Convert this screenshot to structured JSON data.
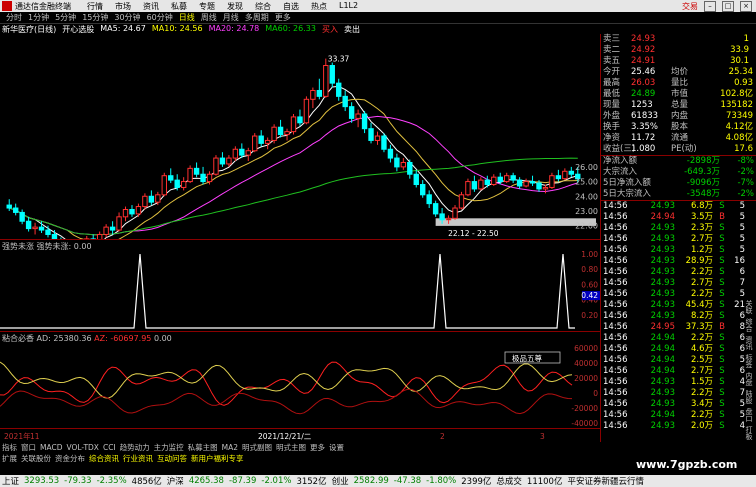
{
  "app": {
    "title": "通达信金融终端",
    "menu": [
      "行情",
      "市场",
      "资讯",
      "私募",
      "专题",
      "发现",
      "综合",
      "自选",
      "热点",
      "L1L2"
    ],
    "trade": "交易"
  },
  "periods": [
    "分时",
    "1分钟",
    "5分钟",
    "15分钟",
    "30分钟",
    "60分钟",
    "日线",
    "周线",
    "月线",
    "多周期",
    "更多"
  ],
  "selected_period": "日线",
  "stock": {
    "name": "新华医疗(日线)",
    "indicator": "开心选股",
    "ma5": "MA5: 24.67",
    "ma10": "MA10: 24.56",
    "ma20": "MA20: 24.78",
    "ma60": "MA60: 26.33",
    "buy": "买入",
    "sell": "卖出"
  },
  "price_axis": [
    "26.00",
    "25.00",
    "24.00",
    "23.00",
    "22.00"
  ],
  "annotations": {
    "high": "33.37",
    "low": "19.38",
    "band": "22.12 - 22.50"
  },
  "pane2": {
    "title": "强势未涨  强势未涨: 0.00",
    "axis": [
      "1.00",
      "0.80",
      "0.60",
      "0.40",
      "0.20"
    ],
    "marker": "0.42"
  },
  "pane3": {
    "title": "粘合必香  AD: 25380.36",
    "title2": "AZ: -60697.95",
    "title3": "0.00",
    "axis": [
      "60000",
      "40000",
      "20000",
      "0",
      "-20000",
      "-40000"
    ],
    "box": "极品五尊"
  },
  "dates": [
    "2021年",
    "11",
    "2021/12/21/二",
    "2",
    "3"
  ],
  "quote": [
    {
      "k": "卖三",
      "v": "24.93",
      "n": "1"
    },
    {
      "k": "卖二",
      "v": "24.92",
      "n": "33.9"
    },
    {
      "k": "卖五",
      "v": "24.91",
      "n": "30.1"
    },
    {
      "k": "今开",
      "v": "25.46",
      "k2": "均价",
      "v2": "25.34"
    },
    {
      "k": "最高",
      "v": "26.03",
      "k2": "量比",
      "v2": "0.93"
    },
    {
      "k": "最低",
      "v": "24.89",
      "k2": "市值",
      "v2": "102.8亿"
    },
    {
      "k": "现量",
      "v": "1253",
      "k2": "总量",
      "v2": "135182"
    },
    {
      "k": "外盘",
      "v": "61833",
      "k2": "内盘",
      "v2": "73349"
    },
    {
      "k": "换手",
      "v": "3.35%",
      "k2": "股本",
      "v2": "4.12亿"
    },
    {
      "k": "净资",
      "v": "11.72",
      "k2": "流通",
      "v2": "4.08亿"
    },
    {
      "k": "收益(三)",
      "v": "1.080",
      "k2": "PE(动)",
      "v2": "17.6"
    }
  ],
  "flows": [
    {
      "k": "净流入额",
      "v": "-2898万",
      "p": "-8%"
    },
    {
      "k": "大宗流入",
      "v": "-649.3万",
      "p": "-2%"
    },
    {
      "k": "5日净流入额",
      "v": "-9096万",
      "p": "-7%"
    },
    {
      "k": "5日大宗流入",
      "v": "-3548万",
      "p": "-2%"
    }
  ],
  "ticks": [
    {
      "t": "14:56",
      "p": "24.93",
      "v": "6.8万",
      "f": "S",
      "n": "5"
    },
    {
      "t": "14:56",
      "p": "24.94",
      "v": "3.5万",
      "f": "B",
      "n": "5"
    },
    {
      "t": "14:56",
      "p": "24.93",
      "v": "2.3万",
      "f": "S",
      "n": "5"
    },
    {
      "t": "14:56",
      "p": "24.93",
      "v": "2.7万",
      "f": "S",
      "n": "5"
    },
    {
      "t": "14:56",
      "p": "24.93",
      "v": "1.2万",
      "f": "S",
      "n": "5"
    },
    {
      "t": "14:56",
      "p": "24.93",
      "v": "28.9万",
      "f": "S",
      "n": "16"
    },
    {
      "t": "14:56",
      "p": "24.93",
      "v": "2.2万",
      "f": "S",
      "n": "6"
    },
    {
      "t": "14:56",
      "p": "24.93",
      "v": "2.7万",
      "f": "S",
      "n": "7"
    },
    {
      "t": "14:56",
      "p": "24.93",
      "v": "2.2万",
      "f": "S",
      "n": "5"
    },
    {
      "t": "14:56",
      "p": "24.93",
      "v": "45.4万",
      "f": "S",
      "n": "21"
    },
    {
      "t": "14:56",
      "p": "24.93",
      "v": "8.2万",
      "f": "S",
      "n": "6"
    },
    {
      "t": "14:56",
      "p": "24.95",
      "v": "37.3万",
      "f": "B",
      "n": "8"
    },
    {
      "t": "14:56",
      "p": "24.94",
      "v": "2.2万",
      "f": "S",
      "n": "6"
    },
    {
      "t": "14:56",
      "p": "24.94",
      "v": "4.6万",
      "f": "S",
      "n": "6"
    },
    {
      "t": "14:56",
      "p": "24.94",
      "v": "2.5万",
      "f": "S",
      "n": "5"
    },
    {
      "t": "14:56",
      "p": "24.94",
      "v": "2.7万",
      "f": "S",
      "n": "6"
    },
    {
      "t": "14:56",
      "p": "24.93",
      "v": "1.5万",
      "f": "S",
      "n": "4"
    },
    {
      "t": "14:56",
      "p": "24.93",
      "v": "2.2万",
      "f": "S",
      "n": "7"
    },
    {
      "t": "14:56",
      "p": "24.93",
      "v": "3.4万",
      "f": "S",
      "n": "5"
    },
    {
      "t": "14:56",
      "p": "24.94",
      "v": "2.2万",
      "f": "S",
      "n": "5"
    },
    {
      "t": "14:56",
      "p": "24.93",
      "v": "2.0万",
      "f": "S",
      "n": "4"
    }
  ],
  "tabs1": [
    "指标",
    "窗口",
    "MACD",
    "VOL-TDX",
    "CCI",
    "趋势动力",
    "主力监控",
    "私募主图",
    "MA2",
    "明式副图",
    "明式主图",
    "更多",
    "设置"
  ],
  "tabs2": [
    "扩展",
    "关联股份",
    "资金分布",
    "综合资讯",
    "行业资讯",
    "互动问答",
    "新用户福利专享"
  ],
  "ticker": [
    {
      "name": "上证",
      "v": "3293.53",
      "c": "-79.33",
      "p": "-2.35%",
      "a": "4856亿"
    },
    {
      "name": "沪深",
      "v": "4265.38",
      "c": "-87.39",
      "p": "-2.01%",
      "a": "3152亿"
    },
    {
      "name": "创业",
      "v": "2582.99",
      "c": "-47.38",
      "p": "-1.80%",
      "a": "2399亿"
    }
  ],
  "ticker_extra": [
    "总成交",
    "11100亿",
    "平安证券新疆云行情"
  ],
  "watermark": "www.7gpzb.com",
  "side_labels": [
    "关联",
    "综合",
    "资讯",
    "标签",
    "内盘",
    "陆股",
    "盘口",
    "打板",
    "预警"
  ],
  "colors": {
    "up": "#ff3030",
    "down": "#00ffff",
    "ma5": "#ffffff",
    "ma10": "#e0c040",
    "ma20": "#ff40ff",
    "ma60": "#20c020"
  },
  "chart_data": {
    "type": "candlestick",
    "ylim": [
      21.5,
      34.5
    ],
    "candles": [
      [
        23.4,
        23.8,
        23.0,
        23.2
      ],
      [
        23.2,
        23.5,
        22.7,
        22.9
      ],
      [
        22.9,
        23.1,
        22.1,
        22.3
      ],
      [
        22.3,
        22.6,
        21.6,
        21.8
      ],
      [
        21.8,
        22.2,
        21.4,
        21.9
      ],
      [
        21.9,
        22.3,
        21.5,
        21.7
      ],
      [
        21.7,
        22.0,
        21.2,
        21.4
      ],
      [
        21.4,
        21.7,
        20.7,
        20.9
      ],
      [
        20.9,
        21.2,
        20.3,
        20.6
      ],
      [
        20.6,
        20.9,
        19.9,
        20.2
      ],
      [
        20.2,
        20.6,
        19.4,
        19.8
      ],
      [
        19.8,
        20.9,
        19.6,
        20.7
      ],
      [
        20.7,
        21.3,
        20.5,
        21.1
      ],
      [
        21.1,
        21.4,
        20.5,
        20.8
      ],
      [
        20.8,
        21.6,
        20.7,
        21.4
      ],
      [
        21.4,
        22.1,
        21.2,
        21.9
      ],
      [
        21.9,
        22.3,
        21.4,
        21.7
      ],
      [
        21.7,
        22.9,
        21.6,
        22.6
      ],
      [
        22.6,
        23.3,
        22.3,
        23.1
      ],
      [
        23.1,
        23.4,
        22.6,
        22.8
      ],
      [
        22.8,
        23.5,
        22.6,
        23.3
      ],
      [
        23.3,
        24.2,
        23.1,
        24.0
      ],
      [
        24.0,
        24.4,
        23.4,
        23.6
      ],
      [
        23.6,
        24.3,
        23.4,
        24.1
      ],
      [
        24.1,
        25.6,
        24.0,
        25.4
      ],
      [
        25.4,
        25.9,
        24.9,
        25.1
      ],
      [
        25.1,
        25.5,
        24.4,
        24.6
      ],
      [
        24.6,
        25.3,
        24.4,
        25.0
      ],
      [
        25.0,
        26.1,
        24.9,
        25.9
      ],
      [
        25.9,
        26.3,
        25.3,
        25.5
      ],
      [
        25.5,
        26.0,
        24.8,
        25.0
      ],
      [
        25.0,
        25.7,
        24.8,
        25.5
      ],
      [
        25.5,
        26.8,
        25.4,
        26.6
      ],
      [
        26.6,
        27.0,
        26.0,
        26.2
      ],
      [
        26.2,
        26.8,
        26.0,
        26.6
      ],
      [
        26.6,
        27.4,
        26.4,
        27.2
      ],
      [
        27.2,
        27.6,
        26.6,
        26.8
      ],
      [
        26.8,
        27.3,
        26.4,
        27.1
      ],
      [
        27.1,
        28.3,
        27.0,
        28.1
      ],
      [
        28.1,
        28.5,
        27.4,
        27.6
      ],
      [
        27.6,
        28.0,
        27.2,
        27.8
      ],
      [
        27.8,
        28.9,
        27.6,
        28.7
      ],
      [
        28.7,
        29.2,
        28.0,
        28.2
      ],
      [
        28.2,
        28.6,
        27.8,
        28.4
      ],
      [
        28.4,
        29.6,
        28.2,
        29.4
      ],
      [
        29.4,
        29.9,
        28.8,
        29.0
      ],
      [
        29.0,
        30.8,
        28.9,
        30.6
      ],
      [
        30.6,
        31.4,
        30.0,
        31.2
      ],
      [
        31.2,
        32.0,
        30.6,
        30.8
      ],
      [
        30.8,
        33.37,
        30.7,
        32.9
      ],
      [
        32.9,
        33.1,
        31.4,
        31.7
      ],
      [
        31.7,
        32.0,
        30.5,
        30.8
      ],
      [
        30.8,
        31.2,
        29.8,
        30.1
      ],
      [
        30.1,
        30.4,
        29.0,
        29.3
      ],
      [
        29.3,
        29.9,
        28.7,
        29.6
      ],
      [
        29.6,
        29.8,
        28.3,
        28.6
      ],
      [
        28.6,
        29.0,
        27.6,
        27.8
      ],
      [
        27.8,
        28.4,
        27.5,
        28.1
      ],
      [
        28.1,
        28.3,
        27.0,
        27.2
      ],
      [
        27.2,
        27.5,
        26.3,
        26.6
      ],
      [
        26.6,
        26.9,
        25.7,
        26.0
      ],
      [
        26.0,
        26.6,
        25.8,
        26.3
      ],
      [
        26.3,
        26.5,
        25.2,
        25.5
      ],
      [
        25.5,
        25.8,
        24.6,
        24.8
      ],
      [
        24.8,
        25.1,
        23.9,
        24.1
      ],
      [
        24.1,
        24.4,
        23.2,
        23.5
      ],
      [
        23.5,
        23.7,
        22.6,
        22.8
      ],
      [
        22.8,
        23.2,
        22.12,
        22.4
      ],
      [
        22.4,
        22.7,
        22.12,
        22.5
      ],
      [
        22.5,
        23.4,
        22.4,
        23.2
      ],
      [
        23.2,
        24.3,
        23.1,
        24.1
      ],
      [
        24.1,
        25.2,
        24.0,
        25.0
      ],
      [
        25.0,
        25.4,
        24.3,
        24.5
      ],
      [
        24.5,
        25.3,
        24.4,
        25.1
      ],
      [
        25.1,
        25.4,
        24.6,
        24.8
      ],
      [
        24.8,
        25.5,
        24.7,
        25.3
      ],
      [
        25.3,
        25.6,
        24.8,
        25.0
      ],
      [
        25.0,
        25.6,
        24.9,
        25.4
      ],
      [
        25.4,
        25.6,
        24.9,
        25.1
      ],
      [
        25.1,
        25.3,
        24.5,
        24.7
      ],
      [
        24.7,
        25.2,
        24.6,
        25.0
      ],
      [
        25.0,
        25.4,
        24.7,
        24.9
      ],
      [
        24.9,
        25.1,
        24.3,
        24.5
      ],
      [
        24.5,
        24.8,
        24.2,
        24.6
      ],
      [
        24.6,
        25.6,
        24.5,
        25.4
      ],
      [
        25.4,
        25.8,
        25.0,
        25.2
      ],
      [
        25.2,
        25.9,
        25.1,
        25.7
      ],
      [
        25.7,
        26.0,
        25.3,
        25.5
      ],
      [
        25.5,
        26.0,
        24.9,
        25.2
      ]
    ]
  }
}
